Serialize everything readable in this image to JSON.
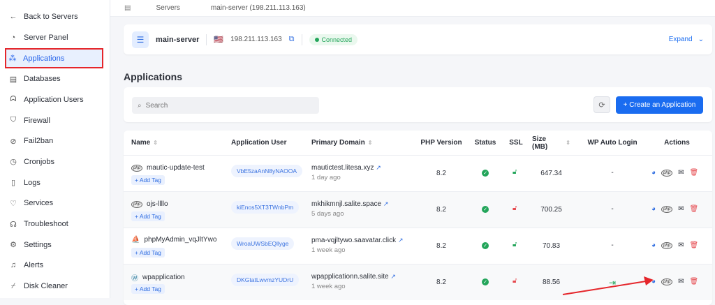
{
  "sidebar": {
    "items": [
      {
        "label": "Back to Servers",
        "icon": "arrow-left-icon"
      },
      {
        "label": "Server Panel",
        "icon": "gauge-icon"
      },
      {
        "label": "Applications",
        "icon": "apps-icon",
        "active": true
      },
      {
        "label": "Databases",
        "icon": "database-icon"
      },
      {
        "label": "Application Users",
        "icon": "users-icon"
      },
      {
        "label": "Firewall",
        "icon": "shield-icon"
      },
      {
        "label": "Fail2ban",
        "icon": "ban-icon"
      },
      {
        "label": "Cronjobs",
        "icon": "clock-icon"
      },
      {
        "label": "Logs",
        "icon": "file-icon"
      },
      {
        "label": "Services",
        "icon": "heartbeat-icon"
      },
      {
        "label": "Troubleshoot",
        "icon": "headset-icon"
      },
      {
        "label": "Settings",
        "icon": "gear-icon"
      },
      {
        "label": "Alerts",
        "icon": "bell-icon"
      },
      {
        "label": "Disk Cleaner",
        "icon": "broom-icon"
      }
    ]
  },
  "breadcrumb": [
    "Servers",
    "main-server (198.211.113.163)"
  ],
  "server": {
    "name": "main-server",
    "ip": "198.211.113.163",
    "status": "Connected",
    "expand": "Expand"
  },
  "page_title": "Applications",
  "search": {
    "placeholder": "Search"
  },
  "create_label": "+ Create an Application",
  "table": {
    "headers": [
      "Name",
      "Application User",
      "Primary Domain",
      "PHP Version",
      "Status",
      "SSL",
      "Size (MB)",
      "WP Auto Login",
      "Actions"
    ],
    "add_tag": "+ Add Tag",
    "rows": [
      {
        "name": "mautic-update-test",
        "icon": "php-icon",
        "user": "VbE5zaAnN8yNAOOA",
        "domain": "mautictest.litesa.xyz",
        "age": "1 day ago",
        "php": "8.2",
        "ssl": "green",
        "size": "647.34",
        "wp": "-"
      },
      {
        "name": "ojs-llllo",
        "icon": "php-icon",
        "user": "kiEnos5XT3TWnbPm",
        "domain": "mkhikmnjl.salite.space",
        "age": "5 days ago",
        "php": "8.2",
        "ssl": "red",
        "size": "700.25",
        "wp": "-"
      },
      {
        "name": "phpMyAdmin_vqJltYwo",
        "icon": "phpmyadmin-icon",
        "user": "WroaUWSbEQllyge",
        "domain": "pma-vqjltywo.saavatar.click",
        "age": "1 week ago",
        "php": "8.2",
        "ssl": "green",
        "size": "70.83",
        "wp": "-"
      },
      {
        "name": "wpapplication",
        "icon": "wordpress-icon",
        "user": "DKGtatLwvmzYUDrU",
        "domain": "wpapplicationn.salite.site",
        "age": "1 week ago",
        "php": "8.2",
        "ssl": "red",
        "size": "88.56",
        "wp": "login-icon"
      }
    ]
  },
  "colors": {
    "accent": "#1a6cf0",
    "highlight": "#e5262b",
    "success": "#23a55a"
  }
}
